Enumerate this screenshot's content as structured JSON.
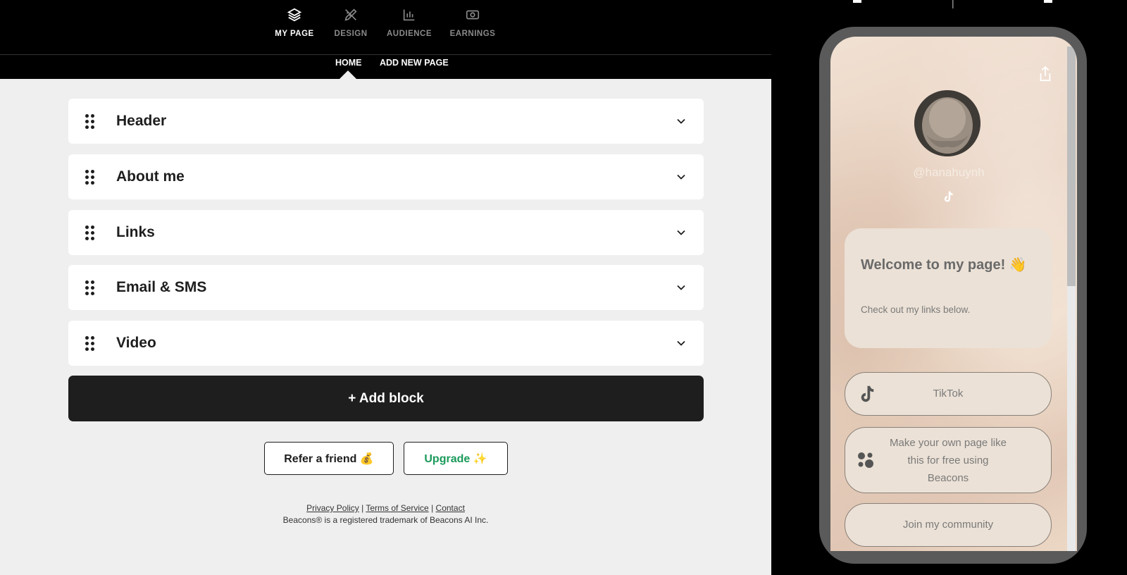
{
  "topnav": {
    "items": [
      {
        "label": "MY PAGE",
        "icon": "layers-icon",
        "active": true
      },
      {
        "label": "DESIGN",
        "icon": "pencil-ruler-icon",
        "active": false
      },
      {
        "label": "AUDIENCE",
        "icon": "bar-chart-icon",
        "active": false
      },
      {
        "label": "EARNINGS",
        "icon": "dollar-bill-icon",
        "active": false
      }
    ]
  },
  "subnav": {
    "tabs": [
      {
        "label": "HOME",
        "active": true
      },
      {
        "label": "ADD NEW PAGE",
        "active": false
      }
    ]
  },
  "blocks": [
    {
      "title": "Header"
    },
    {
      "title": "About me"
    },
    {
      "title": "Links"
    },
    {
      "title": "Email & SMS"
    },
    {
      "title": "Video"
    }
  ],
  "add_block_label": "+ Add block",
  "refer_label": "Refer a friend 💰",
  "upgrade_label": "Upgrade ✨",
  "footer": {
    "privacy": "Privacy Policy",
    "sep1": "|",
    "terms": "Terms of Service",
    "sep2": "|",
    "contact": "Contact",
    "trademark": "Beacons® is a registered trademark of Beacons AI Inc."
  },
  "preview": {
    "handle": "@hanahuynh",
    "welcome_title": "Welcome to my page! 👋",
    "welcome_body": "Check out my links below.",
    "links": [
      {
        "label": "TikTok",
        "icon": "tiktok-icon"
      },
      {
        "label_line1": "Make your own page like",
        "label_line2": "this for free using",
        "label_line3": "Beacons",
        "icon": "beacons-logo-icon"
      },
      {
        "label": "Join my community"
      }
    ]
  },
  "colors": {
    "editor_bg": "#efefef",
    "topbar_bg": "#000000",
    "add_block_bg": "#1e1e1e",
    "upgrade_text": "#1a9a5a",
    "preview_card": "#ebe1d6"
  }
}
